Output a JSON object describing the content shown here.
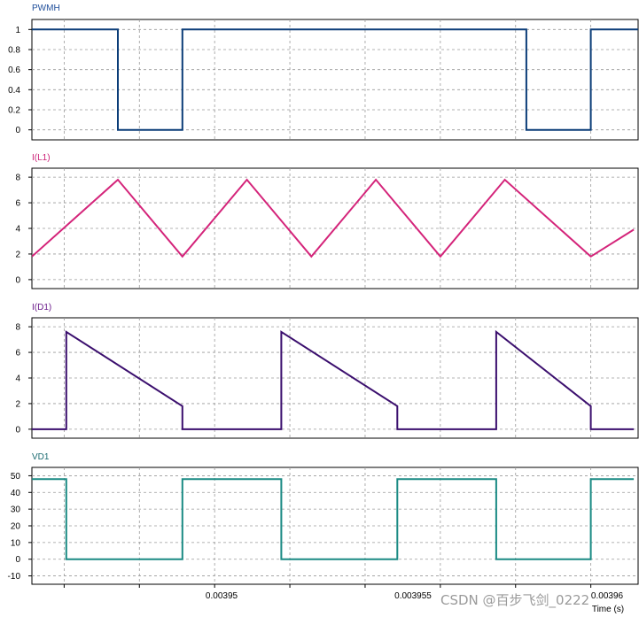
{
  "chart_data": [
    {
      "type": "line",
      "title": "PWMH",
      "title_color": "#1f4e9a",
      "line_color": "#0b3d78",
      "yticks": [
        0,
        0.2,
        0.4,
        0.6,
        0.8,
        1
      ],
      "ytick_labels": [
        "0",
        "0.2",
        "0.4",
        "0.6",
        "0.8",
        "1"
      ],
      "ylim": [
        -0.1,
        1.1
      ],
      "grid": true,
      "series": [
        {
          "x": [
            0.0039425,
            0.0039445,
            0.0039445,
            0.003946,
            0.003946,
            0.003954,
            0.003954,
            0.0039555,
            0.0039555,
            0.003963,
            0.003963,
            0.0039645,
            0.0039645
          ],
          "values": [
            1,
            1,
            0,
            0,
            1,
            1,
            0,
            0,
            1,
            1,
            0,
            0,
            1
          ]
        }
      ]
    },
    {
      "type": "line",
      "title": "I(L1)",
      "title_color": "#cc2277",
      "line_color": "#d4247a",
      "yticks": [
        0,
        2,
        4,
        6,
        8
      ],
      "ytick_labels": [
        "0",
        "2",
        "4",
        "6",
        "8"
      ],
      "ylim": [
        -0.7,
        8.7
      ],
      "grid": true,
      "series": [
        {
          "x": [
            0.0039425,
            0.0039445,
            0.003946,
            0.0039475,
            0.003949,
            0.0039505,
            0.003952,
            0.0039535,
            0.0039555,
            0.0039565
          ],
          "values": [
            1.8,
            7.8,
            1.8,
            7.8,
            1.8,
            7.8,
            1.8,
            7.8,
            1.8,
            3.9
          ]
        }
      ]
    },
    {
      "type": "line",
      "title": "I(D1)",
      "title_color": "#6a1a8a",
      "line_color": "#3b0f6e",
      "yticks": [
        0,
        2,
        4,
        6,
        8
      ],
      "ytick_labels": [
        "0",
        "2",
        "4",
        "6",
        "8"
      ],
      "ylim": [
        -0.7,
        8.7
      ],
      "grid": true,
      "series": [
        {
          "x": [
            0.0039425,
            0.0039433,
            0.0039433,
            0.003946,
            0.003946,
            0.0039483,
            0.0039483,
            0.003951,
            0.003951,
            0.0039533,
            0.0039533,
            0.0039555,
            0.0039555,
            0.0039565
          ],
          "values": [
            0,
            0,
            7.6,
            1.8,
            0,
            0,
            7.6,
            1.8,
            0,
            0,
            7.6,
            1.8,
            0,
            0
          ]
        }
      ]
    },
    {
      "type": "line",
      "title": "VD1",
      "title_color": "#1a6a70",
      "line_color": "#1a8a84",
      "yticks": [
        -10,
        0,
        10,
        20,
        30,
        40,
        50
      ],
      "ytick_labels": [
        "-10",
        "0",
        "10",
        "20",
        "30",
        "40",
        "50"
      ],
      "ylim": [
        -15,
        55
      ],
      "grid": true,
      "series": [
        {
          "x": [
            0.0039425,
            0.0039433,
            0.0039433,
            0.003946,
            0.003946,
            0.0039483,
            0.0039483,
            0.003951,
            0.003951,
            0.0039533,
            0.0039533,
            0.0039555,
            0.0039555,
            0.0039565
          ],
          "values": [
            48,
            48,
            0,
            0,
            48,
            48,
            0,
            0,
            48,
            48,
            0,
            0,
            48,
            48
          ]
        }
      ]
    }
  ],
  "x_axis": {
    "xlim": [
      0.0039425,
      0.0039566
    ],
    "grid_x": [
      0.00394325,
      0.003945,
      0.00394675,
      0.0039485,
      0.00395025,
      0.003952,
      0.00395375,
      0.0039555
    ],
    "tick_labels": [
      "0.00395",
      "0.003955",
      "0.00396"
    ],
    "label": "Time (s)"
  },
  "watermark": "CSDN @百步飞剑_0222"
}
